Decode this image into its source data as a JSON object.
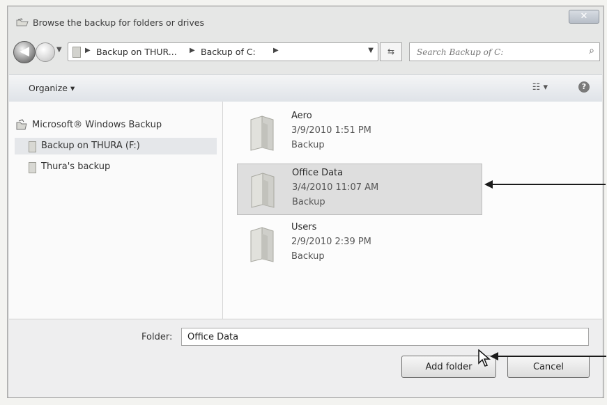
{
  "window": {
    "title": "Browse the backup for folders or drives",
    "close_symbol": "✕"
  },
  "navigation": {
    "back_symbol": "◀",
    "breadcrumbs": [
      "Backup on THUR...",
      "Backup of C:"
    ],
    "search_placeholder": "Search Backup of C:"
  },
  "toolbar": {
    "organize_label": "Organize",
    "view_label": "☷",
    "help_label": "?"
  },
  "nav_pane": {
    "root_label": "Microsoft® Windows Backup",
    "items": [
      "Backup on THURA (F:)",
      "Thura's backup"
    ],
    "selected_index": 0
  },
  "files": [
    {
      "name": "Aero",
      "date": "3/9/2010 1:51 PM",
      "type": "Backup"
    },
    {
      "name": "Office Data",
      "date": "3/4/2010 11:07 AM",
      "type": "Backup"
    },
    {
      "name": "Users",
      "date": "2/9/2010 2:39 PM",
      "type": "Backup"
    }
  ],
  "selected_file_index": 1,
  "footer": {
    "folder_label": "Folder:",
    "folder_value": "Office Data",
    "add_button": "Add folder",
    "cancel_button": "Cancel"
  },
  "icons": {
    "title": "backup-folder-icon",
    "search": "search-icon",
    "help": "help-icon",
    "cursor": "cursor-icon"
  }
}
